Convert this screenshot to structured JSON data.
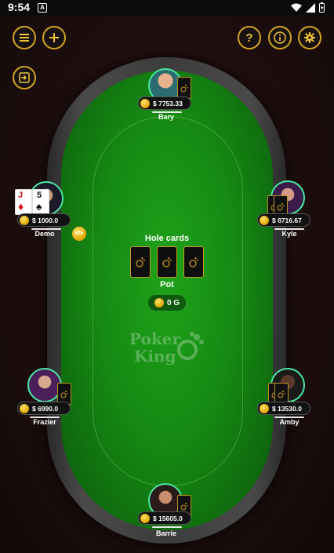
{
  "status_bar": {
    "time": "9:54",
    "notif_letter": "A"
  },
  "controls": {
    "menu_icon": "menu-icon",
    "add_icon": "plus-icon",
    "help_label": "?",
    "info_label": "i",
    "settings_icon": "gear-icon",
    "exit_icon": "exit-icon"
  },
  "center": {
    "hole_cards_label": "Hole cards",
    "pot_label": "Pot",
    "pot_value": "0 G"
  },
  "logo": {
    "line1": "Poker",
    "line2": "King"
  },
  "dealer_button": "BTN",
  "players": {
    "bary": {
      "name": "Bary",
      "chips": "$ 7753.33"
    },
    "demo": {
      "name": "Demo",
      "chips": "$ 1000.0",
      "cards": [
        {
          "rank": "J",
          "suit": "♦"
        },
        {
          "rank": "5",
          "suit": "♠"
        }
      ]
    },
    "kyle": {
      "name": "Kyle",
      "chips": "$ 8716.67"
    },
    "frazier": {
      "name": "Frazier",
      "chips": "$ 6990.0"
    },
    "amby": {
      "name": "Amby",
      "chips": "$ 13530.0"
    },
    "barrie": {
      "name": "Barrie",
      "chips": "$ 15605.0"
    }
  },
  "colors": {
    "accent": "#d4a520",
    "felt": "#168a13",
    "avatar_ring": "#49e8a2"
  }
}
